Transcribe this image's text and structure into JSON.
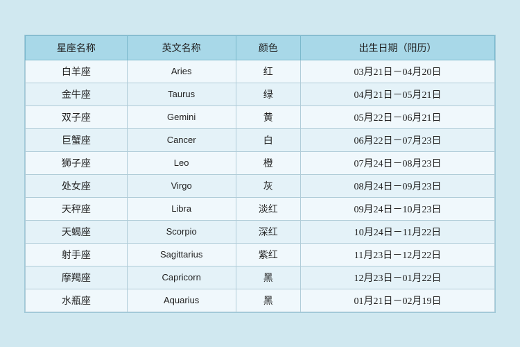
{
  "table": {
    "headers": [
      {
        "key": "zh_name",
        "label": "星座名称"
      },
      {
        "key": "en_name",
        "label": "英文名称"
      },
      {
        "key": "color",
        "label": "颜色"
      },
      {
        "key": "date_range",
        "label": "出生日期（阳历）"
      }
    ],
    "rows": [
      {
        "zh_name": "白羊座",
        "en_name": "Aries",
        "color": "红",
        "date_range": "03月21日－04月20日"
      },
      {
        "zh_name": "金牛座",
        "en_name": "Taurus",
        "color": "绿",
        "date_range": "04月21日－05月21日"
      },
      {
        "zh_name": "双子座",
        "en_name": "Gemini",
        "color": "黄",
        "date_range": "05月22日－06月21日"
      },
      {
        "zh_name": "巨蟹座",
        "en_name": "Cancer",
        "color": "白",
        "date_range": "06月22日－07月23日"
      },
      {
        "zh_name": "狮子座",
        "en_name": "Leo",
        "color": "橙",
        "date_range": "07月24日－08月23日"
      },
      {
        "zh_name": "处女座",
        "en_name": "Virgo",
        "color": "灰",
        "date_range": "08月24日－09月23日"
      },
      {
        "zh_name": "天秤座",
        "en_name": "Libra",
        "color": "淡红",
        "date_range": "09月24日－10月23日"
      },
      {
        "zh_name": "天蝎座",
        "en_name": "Scorpio",
        "color": "深红",
        "date_range": "10月24日－11月22日"
      },
      {
        "zh_name": "射手座",
        "en_name": "Sagittarius",
        "color": "紫红",
        "date_range": "11月23日－12月22日"
      },
      {
        "zh_name": "摩羯座",
        "en_name": "Capricorn",
        "color": "黑",
        "date_range": "12月23日－01月22日"
      },
      {
        "zh_name": "水瓶座",
        "en_name": "Aquarius",
        "color": "黑",
        "date_range": "01月21日－02月19日"
      }
    ]
  }
}
